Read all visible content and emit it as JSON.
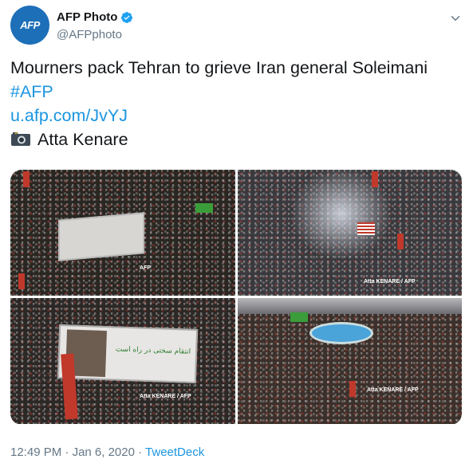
{
  "author": {
    "display_name": "AFP Photo",
    "handle": "@AFPphoto",
    "avatar_text": "AFP",
    "verified": true
  },
  "tweet": {
    "line1": "Mourners pack Tehran to grieve Iran general Soleimani",
    "hashtag": "#AFP",
    "link": "u.afp.com/JvYJ",
    "photographer": "Atta Kenare"
  },
  "media": {
    "images": [
      {
        "watermark": "AFP"
      },
      {
        "watermark": "Atta KENARE / AFP"
      },
      {
        "watermark": "Atta KENARE / AFP"
      },
      {
        "watermark": "Atta KENARE / AFP"
      }
    ],
    "banner_text": "انتقام سختی در راه است"
  },
  "footer": {
    "time": "12:49 PM",
    "separator": " · ",
    "date": "Jan 6, 2020",
    "source": "TweetDeck"
  },
  "colors": {
    "link": "#1b95e0",
    "avatar_bg": "#1d6fb8",
    "verified": "#1da1f2",
    "secondary_text": "#657786"
  }
}
